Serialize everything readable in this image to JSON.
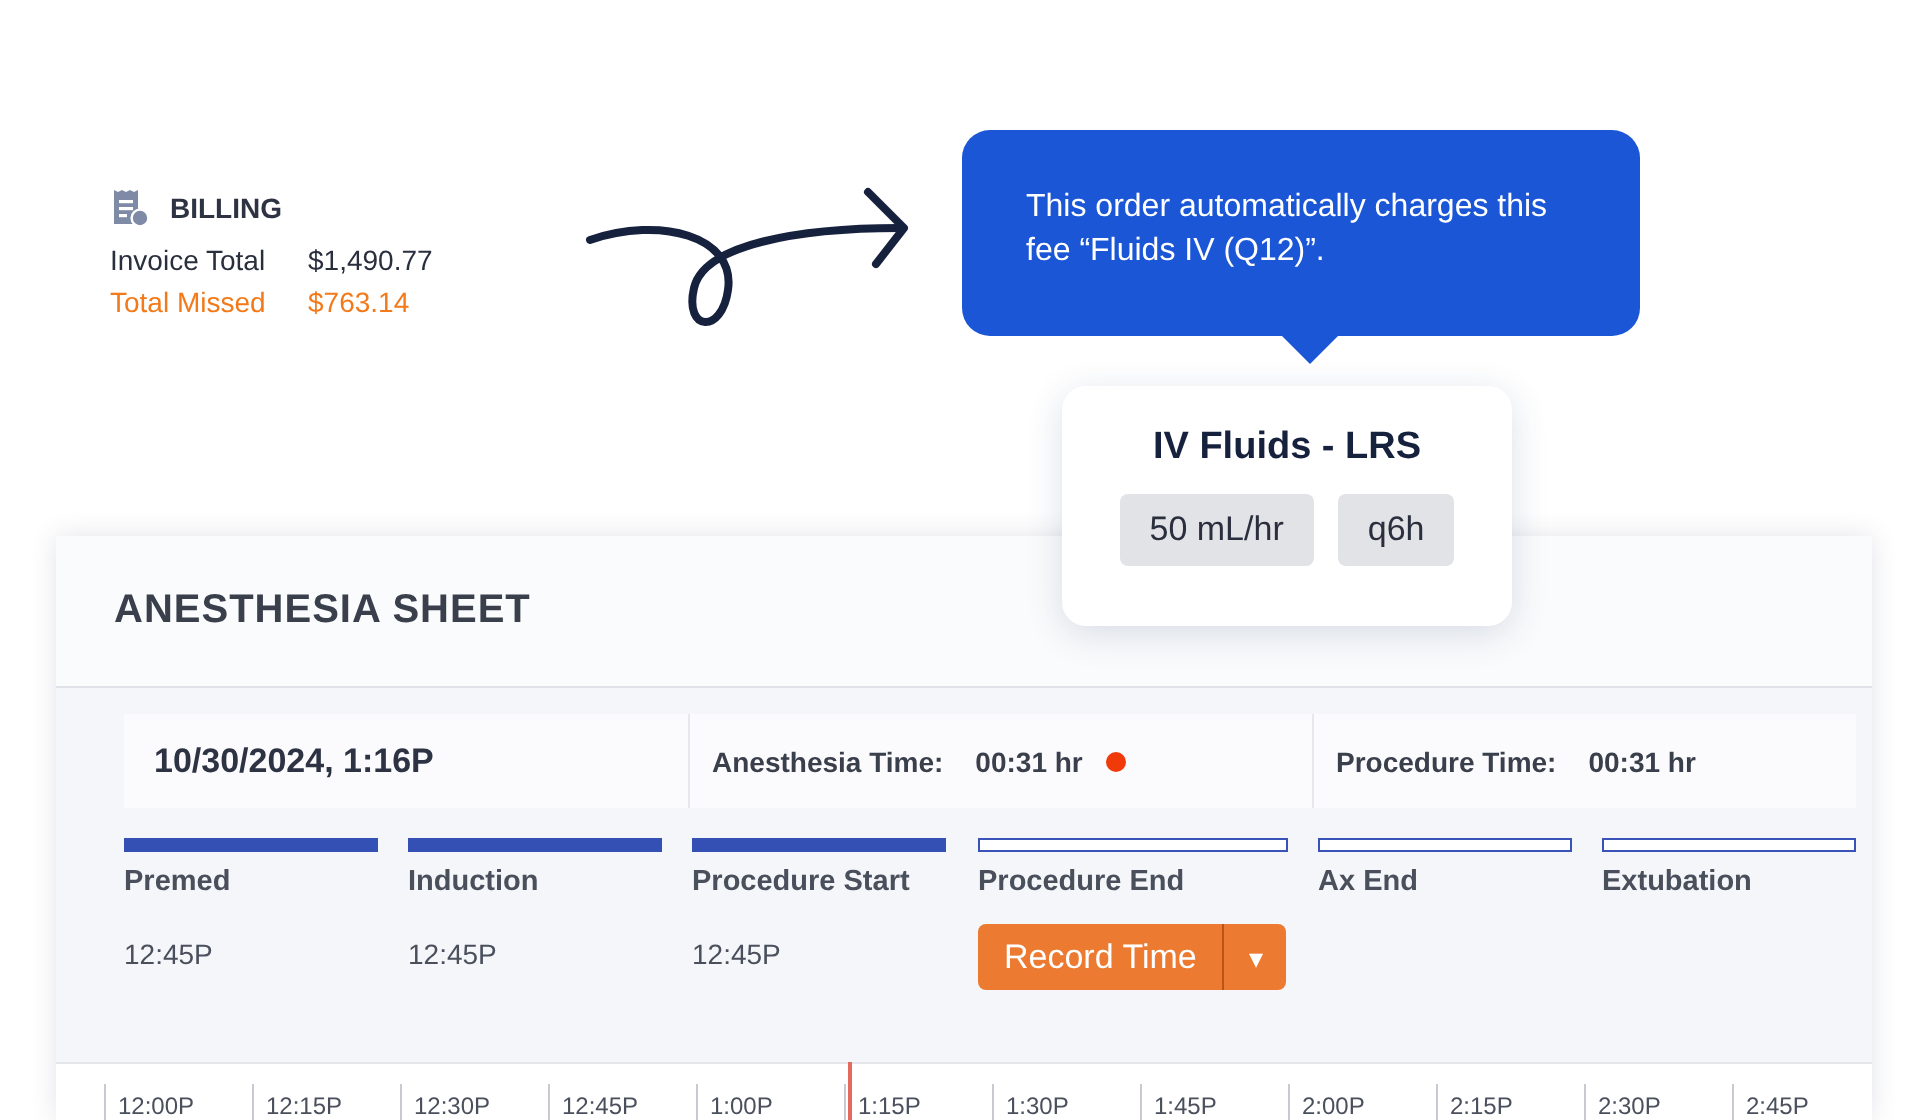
{
  "billing": {
    "title": "BILLING",
    "lines": [
      {
        "label": "Invoice Total",
        "value": "$1,490.77",
        "missed": false
      },
      {
        "label": "Total Missed",
        "value": "$763.14",
        "missed": true
      }
    ]
  },
  "tooltip": {
    "text": "This order automatically charges this fee “Fluids IV (Q12)”."
  },
  "order_card": {
    "title": "IV Fluids - LRS",
    "chips": [
      "50 mL/hr",
      "q6h"
    ]
  },
  "sheet": {
    "title": "ANESTHESIA SHEET",
    "info": {
      "datetime": "10/30/2024, 1:16P",
      "anesthesia": {
        "label": "Anesthesia Time:",
        "value": "00:31 hr",
        "live": true
      },
      "procedure": {
        "label": "Procedure Time:",
        "value": "00:31 hr",
        "live": false
      }
    },
    "milestones": [
      {
        "label": "Premed",
        "done": true,
        "kind": "time",
        "time": "12:45P"
      },
      {
        "label": "Induction",
        "done": true,
        "kind": "time",
        "time": "12:45P"
      },
      {
        "label": "Procedure Start",
        "done": true,
        "kind": "time",
        "time": "12:45P"
      },
      {
        "label": "Procedure End",
        "done": false,
        "kind": "record",
        "button": "Record Time",
        "menu": "▾"
      },
      {
        "label": "Ax End",
        "done": false,
        "kind": "empty"
      },
      {
        "label": "Extubation",
        "done": false,
        "kind": "empty"
      }
    ],
    "timeline": [
      {
        "label": "12:00P",
        "current": false
      },
      {
        "label": "12:15P",
        "current": false
      },
      {
        "label": "12:30P",
        "current": false
      },
      {
        "label": "12:45P",
        "current": false
      },
      {
        "label": "1:00P",
        "current": false
      },
      {
        "label": "1:15P",
        "current": true
      },
      {
        "label": "1:30P",
        "current": false
      },
      {
        "label": "1:45P",
        "current": false
      },
      {
        "label": "2:00P",
        "current": false
      },
      {
        "label": "2:15P",
        "current": false
      },
      {
        "label": "2:30P",
        "current": false
      },
      {
        "label": "2:45P",
        "current": false
      }
    ]
  }
}
